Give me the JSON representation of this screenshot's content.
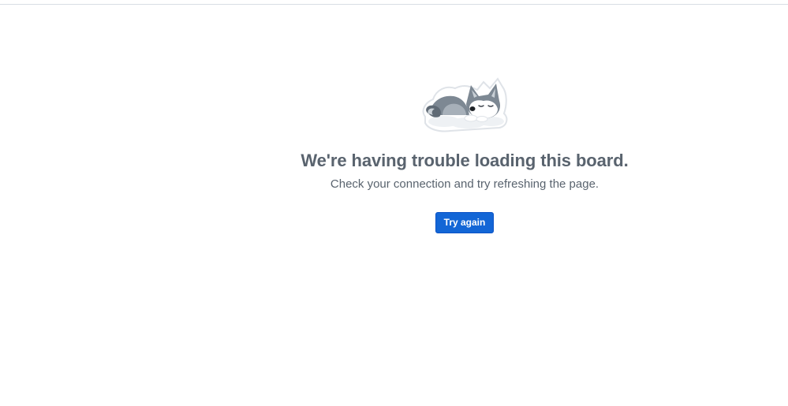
{
  "error": {
    "illustration_icon": "sleeping-husky-icon",
    "title": "We're having trouble loading this board.",
    "subtitle": "Check your connection and try refreshing the page.",
    "retry_label": "Try again"
  },
  "colors": {
    "text_muted": "#59636e",
    "button_primary": "#1366d6",
    "divider": "#d8dee4"
  }
}
